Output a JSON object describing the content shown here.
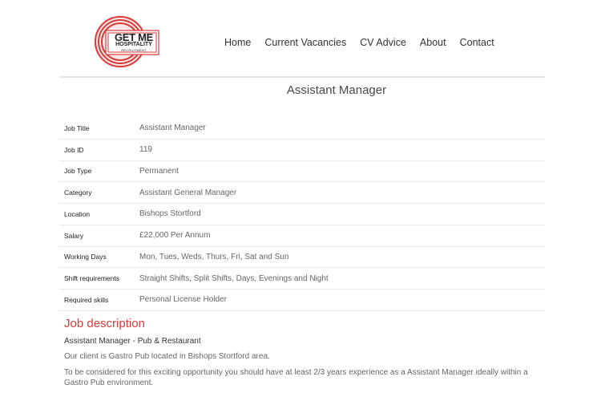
{
  "brand": {
    "logo_line1": "GET ME",
    "logo_line2": "HOSPITALITY",
    "logo_line3": "RECRUITMENT",
    "accent_color": "#d83a3a"
  },
  "nav": {
    "items": [
      {
        "label": "Home"
      },
      {
        "label": "Current Vacancies"
      },
      {
        "label": "CV Advice"
      },
      {
        "label": "About"
      },
      {
        "label": "Contact"
      }
    ]
  },
  "page_title": "Assistant Manager",
  "job": {
    "rows": [
      {
        "label": "Job Title",
        "value": "Assistant Manager"
      },
      {
        "label": "Job ID",
        "value": "119"
      },
      {
        "label": "Job Type",
        "value": "Permanent"
      },
      {
        "label": "Category",
        "value": "Assistant General Manager"
      },
      {
        "label": "Location",
        "value": "Bishops Stortford"
      },
      {
        "label": "Salary",
        "value": "£22,000 Per Annum"
      },
      {
        "label": "Working Days",
        "value": "Mon, Tues, Weds, Thurs, Fri, Sat and Sun"
      },
      {
        "label": "Shift requirements",
        "value": "Straight Shifts, Split Shifts, Days, Evenings and Night"
      },
      {
        "label": "Required skills",
        "value": "Personal License Holder"
      }
    ]
  },
  "description": {
    "heading": "Job description",
    "subtitle": "Assistant Manager - Pub & Restaurant",
    "paragraph1": "Our client is Gastro Pub  located in Bishops Stortford area.",
    "paragraph2": "To be considered for this exciting opportunity you should have at least 2/3 years experience as a Assistant Manager ideally within a Gastro Pub environment."
  }
}
